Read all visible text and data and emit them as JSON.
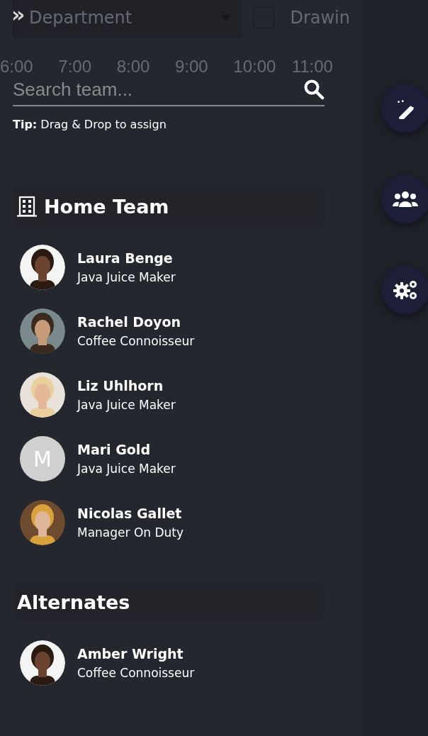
{
  "background": {
    "expand_icon": "»",
    "department_select": {
      "value": "Department"
    },
    "view_checkbox": {
      "checked": false
    },
    "view_label": "Drawin",
    "timeline": [
      "6:00",
      "7:00",
      "8:00",
      "9:00",
      "10:00",
      "11:00"
    ]
  },
  "search": {
    "placeholder": "Search team..."
  },
  "tip": "**Tip:** Drag & Drop to assign",
  "sections": [
    {
      "title": "Home Team",
      "icon": true,
      "members": [
        {
          "name": "Laura Benge",
          "role": "Java Juice Maker"
        },
        {
          "name": "Rachel Doyon",
          "role": "Coffee Connoisseur"
        },
        {
          "name": "Liz Uhlhorn",
          "role": "Java Juice Maker"
        },
        {
          "name": "Mari Gold",
          "role": "Java Juice Maker",
          "avatar": {
            "kind": "initial",
            "initial": "M"
          }
        },
        {
          "name": "Nicolas Gallet",
          "role": "Manager On Duty"
        }
      ]
    },
    {
      "title": "Alternates",
      "icon": false,
      "members": [
        {
          "name": "Amber Wright",
          "role": "Coffee Connoisseur"
        }
      ]
    }
  ],
  "side_buttons": [
    {
      "kind": "wand"
    },
    {
      "kind": "team"
    },
    {
      "kind": "settings"
    }
  ]
}
